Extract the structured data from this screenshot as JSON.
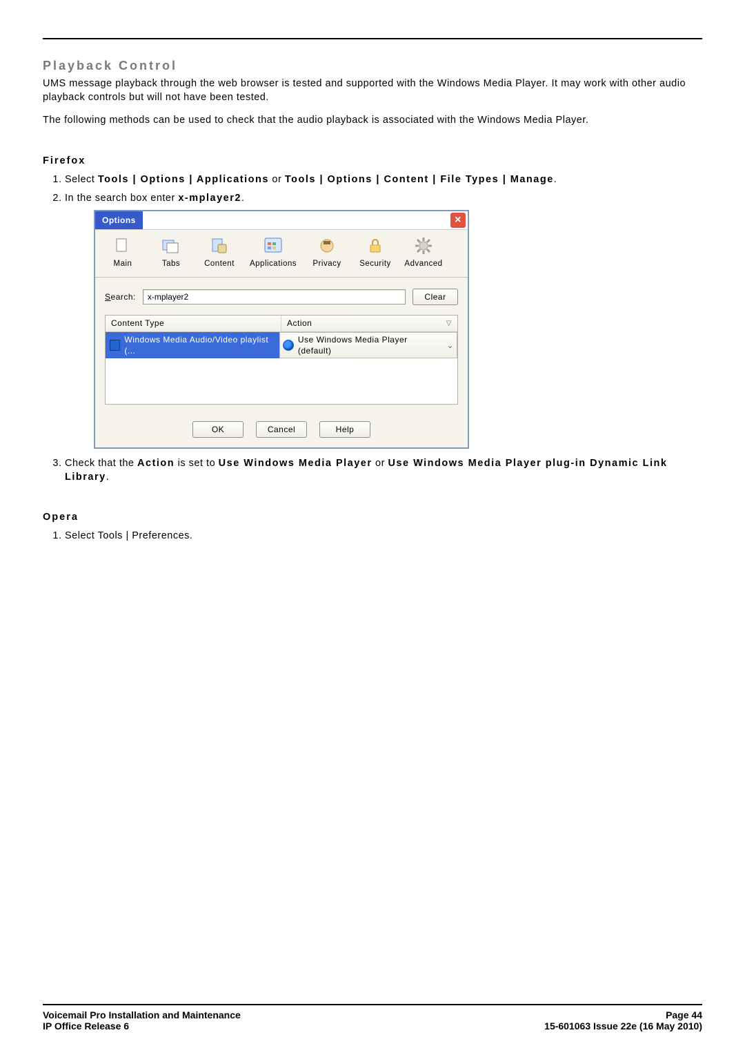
{
  "heading": "Playback Control",
  "para1": "UMS message playback through the web browser is tested and supported with the Windows Media Player. It may work with other audio playback controls but will not have been tested.",
  "para2": "The following methods can be used to check that the audio playback is associated with the Windows Media Player.",
  "firefox": {
    "title": "Firefox",
    "step1_a": "Select ",
    "step1_b": "Tools | Options | Applications",
    "step1_c": " or ",
    "step1_d": "Tools | Options | Content | File Types | Manage",
    "step1_e": ".",
    "step2_a": "In the search box enter ",
    "step2_b": "x-mplayer2",
    "step2_c": ".",
    "step3_a": "Check that the ",
    "step3_b": "Action",
    "step3_c": " is set to ",
    "step3_d": "Use Windows Media Player",
    "step3_e": " or ",
    "step3_f": "Use Windows Media Player plug-in Dynamic Link Library",
    "step3_g": "."
  },
  "opera": {
    "title": "Opera",
    "step1": "Select Tools | Preferences."
  },
  "dialog": {
    "title": "Options",
    "tabs": [
      "Main",
      "Tabs",
      "Content",
      "Applications",
      "Privacy",
      "Security",
      "Advanced"
    ],
    "search_label": "Search:",
    "search_value": "x-mplayer2",
    "clear": "Clear",
    "col_content": "Content Type",
    "col_action": "Action",
    "row_content": "Windows Media Audio/Video playlist (...",
    "row_action": "Use Windows Media Player (default)",
    "ok": "OK",
    "cancel": "Cancel",
    "help": "Help"
  },
  "footer": {
    "left1": "Voicemail Pro Installation and Maintenance",
    "left2": "IP Office Release 6",
    "right1": "Page 44",
    "right2": "15-601063 Issue 22e (16 May 2010)"
  }
}
